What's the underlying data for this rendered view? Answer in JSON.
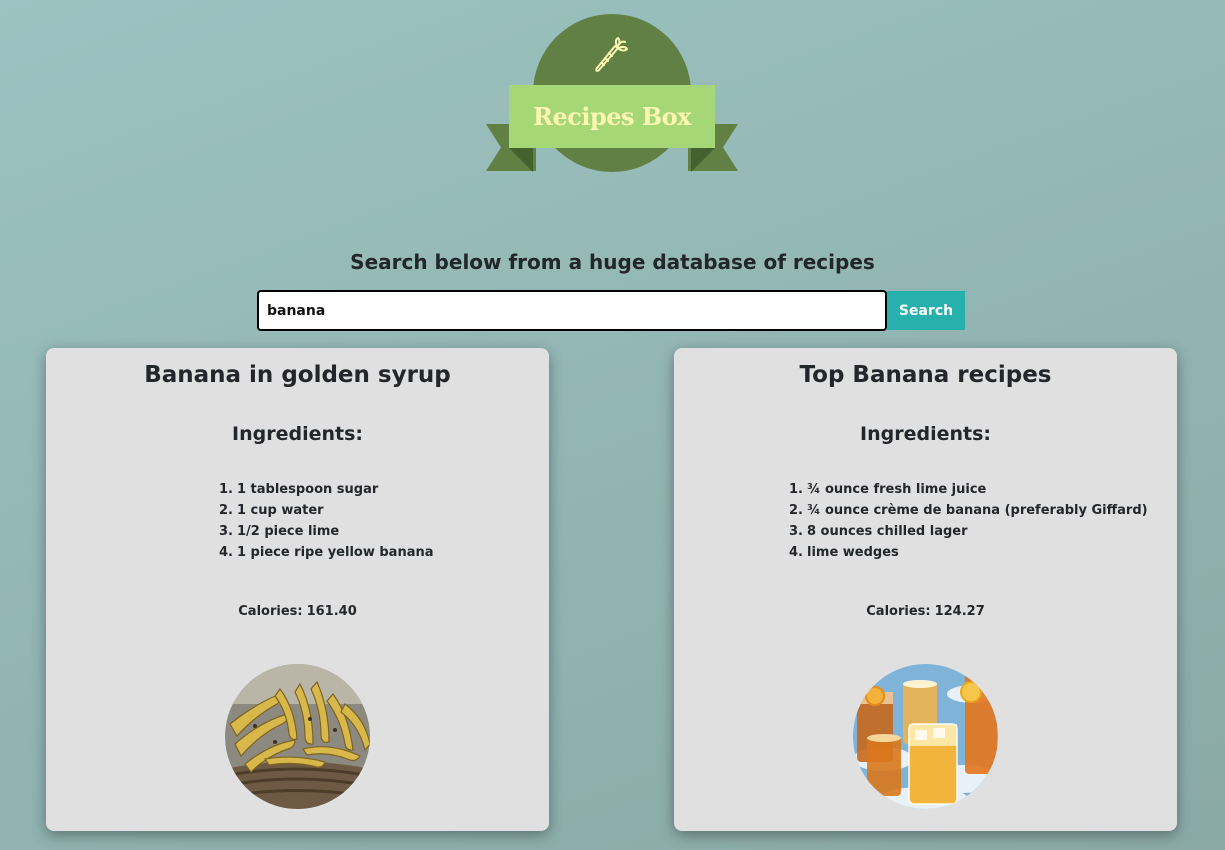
{
  "logo": {
    "title": "Recipes Box",
    "icon": "carrot-icon",
    "colors": {
      "dome": "#608143",
      "banner": "#a6d776",
      "text": "#fdf6b3"
    }
  },
  "search": {
    "tagline": "Search below from a huge database of recipes",
    "value": "banana",
    "button_label": "Search",
    "button_color": "#27b1ac"
  },
  "recipes": [
    {
      "title": "Banana in golden syrup",
      "ingredients_heading": "Ingredients:",
      "ingredients": [
        {
          "num": "1.",
          "text": "1 tablespoon sugar"
        },
        {
          "num": "2.",
          "text": "1 cup water"
        },
        {
          "num": "3.",
          "text": "1/2 piece lime"
        },
        {
          "num": "4.",
          "text": "1 piece ripe yellow banana"
        }
      ],
      "calories_label": "Calories:",
      "calories": "161.40",
      "image": "bananas-photo"
    },
    {
      "title": "Top Banana recipes",
      "ingredients_heading": "Ingredients:",
      "ingredients": [
        {
          "num": "1.",
          "text": "¾ ounce fresh lime juice"
        },
        {
          "num": "2.",
          "text": "¾ ounce crème de banana (preferably Giffard)"
        },
        {
          "num": "3.",
          "text": "8 ounces chilled lager"
        },
        {
          "num": "4.",
          "text": "lime wedges"
        }
      ],
      "calories_label": "Calories:",
      "calories": "124.27",
      "image": "cocktails-photo"
    }
  ]
}
